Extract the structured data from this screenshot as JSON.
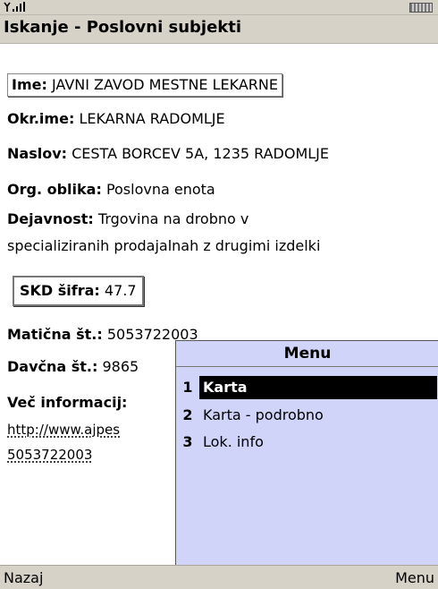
{
  "status": {
    "signal_text": "Y.ıll"
  },
  "header": {
    "title": "Iskanje - Poslovni subjekti"
  },
  "fields": {
    "ime": {
      "label": "Ime:",
      "value": "JAVNI ZAVOD MESTNE LEKARNE"
    },
    "okr_ime": {
      "label": "Okr.ime:",
      "value": "LEKARNA RADOMLJE"
    },
    "naslov": {
      "label": "Naslov:",
      "value": "CESTA BORCEV 5A, 1235 RADOMLJE"
    },
    "org_oblika": {
      "label": "Org. oblika:",
      "value": "Poslovna enota"
    },
    "dejavnost": {
      "label": "Dejavnost:",
      "value_line1": "Trgovina na drobno v",
      "value_line2": "specializiranih prodajalnah z drugimi izdelki"
    },
    "skd": {
      "label": "SKD šifra:",
      "value": "47.7"
    },
    "maticna": {
      "label": "Matična št.:",
      "value": "5053722003"
    },
    "davcna": {
      "label": "Davčna št.:",
      "value": "9865"
    },
    "vec_info": {
      "label": "Več informacij:",
      "link_line1": "http://www.ajpes",
      "link_line2": "5053722003"
    }
  },
  "menu": {
    "title": "Menu",
    "items": [
      {
        "num": "1",
        "label": "Karta",
        "selected": true
      },
      {
        "num": "2",
        "label": "Karta - podrobno",
        "selected": false
      },
      {
        "num": "3",
        "label": "Lok. info",
        "selected": false
      }
    ]
  },
  "softkeys": {
    "left": "Nazaj",
    "right": "Menu"
  }
}
